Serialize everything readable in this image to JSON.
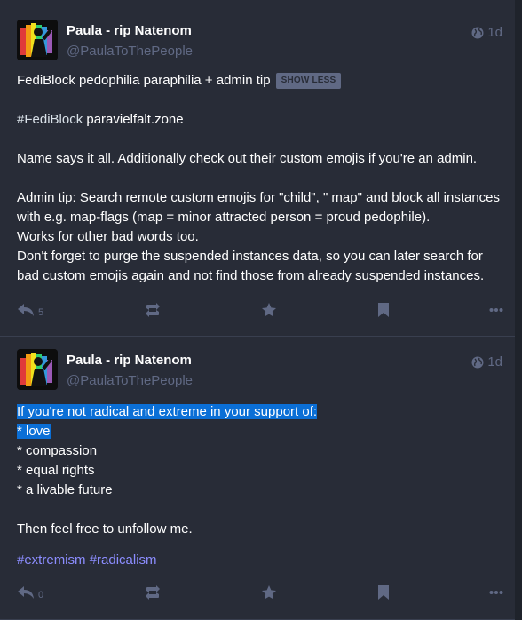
{
  "colors": {
    "background": "#282c37",
    "text": "#ffffff",
    "muted": "#606984",
    "hashtag": "#8c8dff",
    "selection": "#0b6fd6"
  },
  "posts": [
    {
      "display_name": "Paula - rip Natenom",
      "handle": "@PaulaToThePeople",
      "time": "1d",
      "visibility_icon": "globe-icon",
      "spoiler": "FediBlock pedophilia paraphilia + admin tip",
      "show_less": "SHOW LESS",
      "paragraphs": [
        {
          "hashtag": "#FediBlock",
          "text": " paravielfalt.zone"
        },
        {
          "text": "Name says it all. Additionally check out their custom emojis if you're an admin."
        },
        {
          "lines": [
            "Admin tip: Search remote custom emojis for \"child\", \" map\" and block all instances with e.g. map-flags (map = minor attracted person = proud pedophile).",
            "Works for other bad words too.",
            "Don't forget to purge the suspended instances data, so you can later search for bad custom emojis again and not find those from already suspended instances."
          ]
        }
      ],
      "reply_count": "5"
    },
    {
      "display_name": "Paula - rip Natenom",
      "handle": "@PaulaToThePeople",
      "time": "1d",
      "visibility_icon": "globe-icon",
      "lines": [
        "If you're not radical and extreme in your support of:",
        "* love",
        "* compassion",
        "* equal rights",
        "* a livable future"
      ],
      "closing": "Then feel free to unfollow me.",
      "tags": [
        "#extremism",
        "#radicalism"
      ],
      "reply_count": "0"
    }
  ]
}
